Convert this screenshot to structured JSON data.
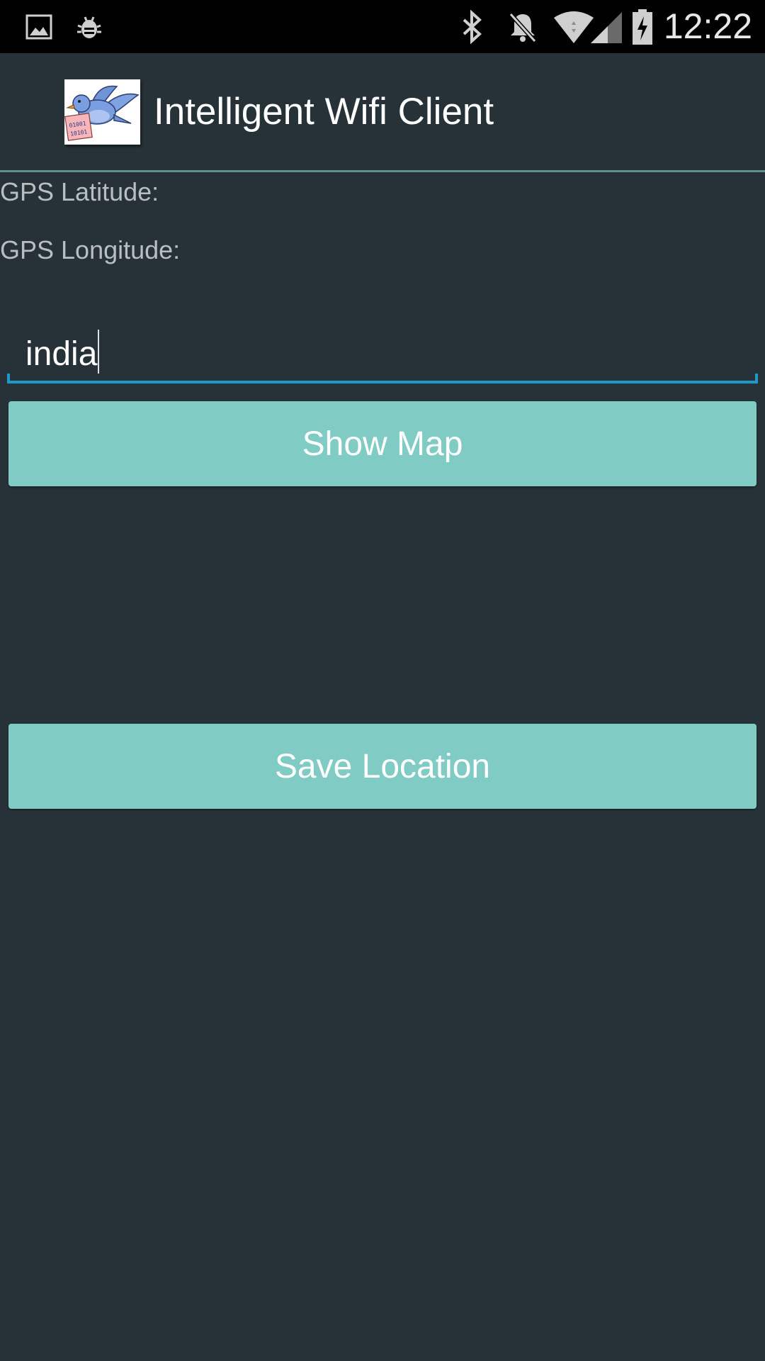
{
  "status_bar": {
    "time": "12:22",
    "icons": [
      "image-notification-icon",
      "bug-icon",
      "bluetooth-icon",
      "notifications-off-icon",
      "wifi-signal-icon",
      "cell-signal-icon",
      "battery-charging-icon"
    ]
  },
  "action_bar": {
    "title": "Intelligent Wifi Client",
    "logo_text": [
      "01001",
      "10101"
    ]
  },
  "labels": {
    "latitude": "GPS Latitude:",
    "longitude": "GPS Longitude:"
  },
  "location_input": {
    "value": "india"
  },
  "buttons": {
    "show_map": "Show Map",
    "save_location": "Save Location"
  },
  "colors": {
    "background": "#263238",
    "button": "#80cbc4",
    "input_underline": "#1e98c9",
    "divider": "#5f8f8f"
  }
}
